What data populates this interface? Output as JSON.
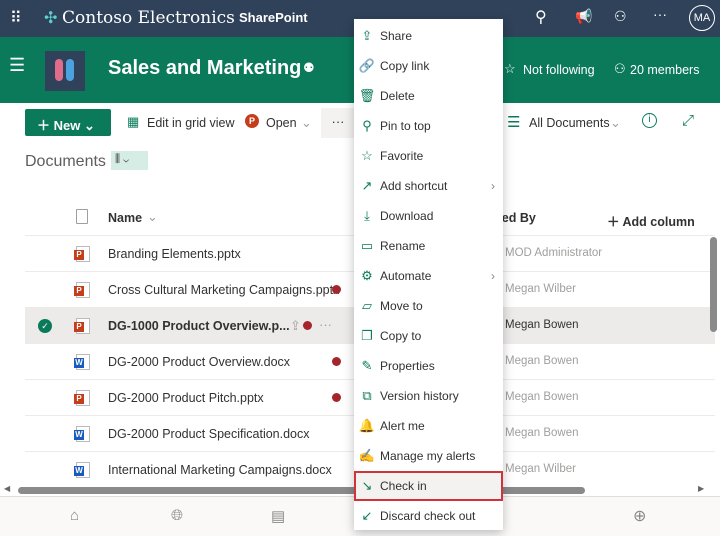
{
  "topbar": {
    "brand": "Contoso Electronics",
    "app": "SharePoint",
    "avatar": "MA"
  },
  "site": {
    "title": "Sales and Marketing",
    "follow": "Not following",
    "members": "20 members"
  },
  "commands": {
    "new": "New",
    "edit_grid": "Edit in grid view",
    "open": "Open",
    "more": "···",
    "view": "All Documents"
  },
  "library": {
    "title": "Documents"
  },
  "columns": {
    "name": "Name",
    "modified_by": "Modified By",
    "add_column": "Add column"
  },
  "files": [
    {
      "name": "Branding Elements.pptx",
      "type": "pptx",
      "checked_out": false,
      "modified_by": "MOD Administrator",
      "selected": false
    },
    {
      "name": "Cross Cultural Marketing Campaigns.pptx",
      "type": "pptx",
      "checked_out": true,
      "modified_by": "Megan Wilber",
      "selected": false
    },
    {
      "name": "DG-1000 Product Overview.p...",
      "type": "pptx",
      "checked_out": true,
      "modified_by": "Megan Bowen",
      "selected": true
    },
    {
      "name": "DG-2000 Product Overview.docx",
      "type": "docx",
      "checked_out": true,
      "modified_by": "Megan Bowen",
      "selected": false
    },
    {
      "name": "DG-2000 Product Pitch.pptx",
      "type": "pptx",
      "checked_out": true,
      "modified_by": "Megan Bowen",
      "selected": false
    },
    {
      "name": "DG-2000 Product Specification.docx",
      "type": "docx",
      "checked_out": false,
      "modified_by": "Megan Bowen",
      "selected": false
    },
    {
      "name": "International Marketing Campaigns.docx",
      "type": "docx",
      "checked_out": false,
      "modified_by": "Megan Wilber",
      "selected": false
    }
  ],
  "menu": [
    {
      "label": "Share",
      "icon": "share-icon",
      "glyph": "⇪"
    },
    {
      "label": "Copy link",
      "icon": "link-icon",
      "glyph": "🔗"
    },
    {
      "label": "Delete",
      "icon": "trash-icon",
      "glyph": "🗑"
    },
    {
      "label": "Pin to top",
      "icon": "pin-icon",
      "glyph": "⚲"
    },
    {
      "label": "Favorite",
      "icon": "star-icon",
      "glyph": "☆"
    },
    {
      "label": "Add shortcut",
      "icon": "shortcut-icon",
      "glyph": "↗",
      "submenu": true
    },
    {
      "label": "Download",
      "icon": "download-icon",
      "glyph": "⤓"
    },
    {
      "label": "Rename",
      "icon": "rename-icon",
      "glyph": "▭"
    },
    {
      "label": "Automate",
      "icon": "automate-icon",
      "glyph": "⚙",
      "submenu": true
    },
    {
      "label": "Move to",
      "icon": "move-icon",
      "glyph": "▱"
    },
    {
      "label": "Copy to",
      "icon": "copy-icon",
      "glyph": "❐"
    },
    {
      "label": "Properties",
      "icon": "pencil-icon",
      "glyph": "✎"
    },
    {
      "label": "Version history",
      "icon": "history-icon",
      "glyph": "⧉"
    },
    {
      "label": "Alert me",
      "icon": "bell-icon",
      "glyph": "🔔"
    },
    {
      "label": "Manage my alerts",
      "icon": "manage-alerts-icon",
      "glyph": "✍"
    },
    {
      "label": "Check in",
      "icon": "check-in-icon",
      "glyph": "↘",
      "highlighted": true
    },
    {
      "label": "Discard check out",
      "icon": "discard-icon",
      "glyph": "↙"
    }
  ],
  "colors": {
    "topbar": "#2f4259",
    "brand": "#0b7a5b",
    "highlight_border": "#d13438"
  }
}
